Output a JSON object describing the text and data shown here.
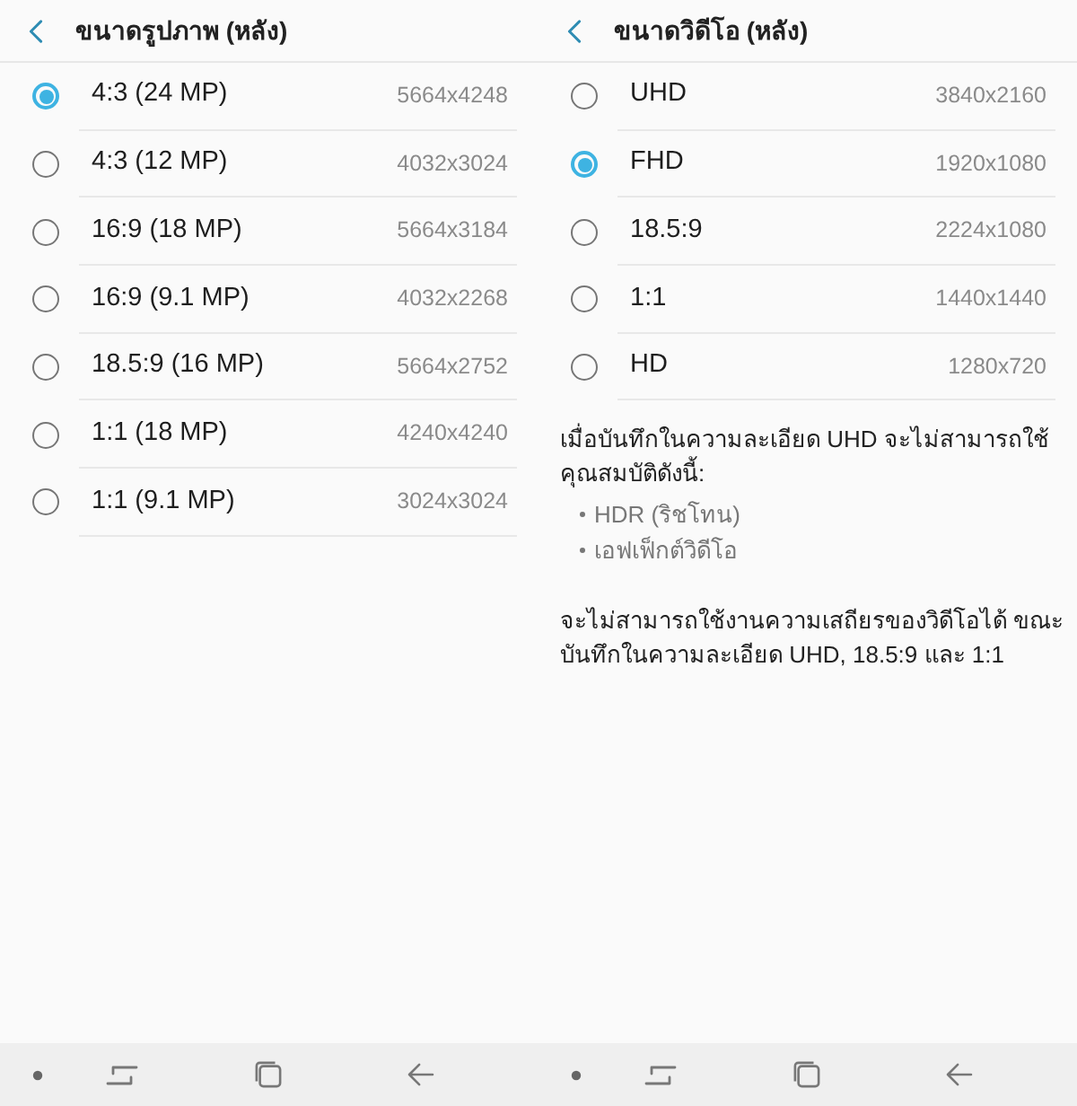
{
  "screens": [
    {
      "header": {
        "title": "ขนาดรูปภาพ (หลัง)"
      },
      "options": [
        {
          "label": "4:3 (24 MP)",
          "resolution": "5664x4248",
          "selected": true
        },
        {
          "label": "4:3 (12 MP)",
          "resolution": "4032x3024",
          "selected": false
        },
        {
          "label": "16:9 (18 MP)",
          "resolution": "5664x3184",
          "selected": false
        },
        {
          "label": "16:9 (9.1 MP)",
          "resolution": "4032x2268",
          "selected": false
        },
        {
          "label": "18.5:9 (16 MP)",
          "resolution": "5664x2752",
          "selected": false
        },
        {
          "label": "1:1 (18 MP)",
          "resolution": "4240x4240",
          "selected": false
        },
        {
          "label": "1:1 (9.1 MP)",
          "resolution": "3024x3024",
          "selected": false
        }
      ]
    },
    {
      "header": {
        "title": "ขนาดวิดีโอ (หลัง)"
      },
      "options": [
        {
          "label": "UHD",
          "resolution": "3840x2160",
          "selected": false
        },
        {
          "label": "FHD",
          "resolution": "1920x1080",
          "selected": true
        },
        {
          "label": "18.5:9",
          "resolution": "2224x1080",
          "selected": false
        },
        {
          "label": "1:1",
          "resolution": "1440x1440",
          "selected": false
        },
        {
          "label": "HD",
          "resolution": "1280x720",
          "selected": false
        }
      ],
      "note": {
        "intro": "เมื่อบันทึกในความละเอียด UHD จะไม่สามารถใช้\nคุณสมบัติดังนี้:",
        "bullets": [
          "HDR (ริชโทน)",
          "เอฟเฟ็กต์วิดีโอ"
        ],
        "footer": "จะไม่สามารถใช้งานความเสถียรของวิดีโอได้ ขณะ\nบันทึกในความละเอียด UHD, 18.5:9 และ 1:1"
      }
    }
  ]
}
